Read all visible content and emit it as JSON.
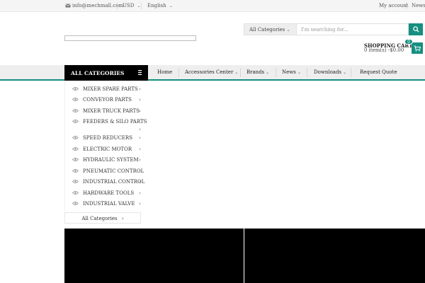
{
  "topbar": {
    "email": "info@mechmall.com",
    "currency": "USD",
    "language": "English",
    "my_account": "My account",
    "news": "News"
  },
  "search": {
    "category": "All Categories",
    "placeholder": "I'm searching for..."
  },
  "cart": {
    "title": "SHOPPING CART",
    "summary": "0 item(s) -$0.00",
    "count": "0"
  },
  "nav": {
    "all_categories": "ALL CATEGORIES",
    "items": [
      {
        "label": "Home"
      },
      {
        "label": "Accessories Center"
      },
      {
        "label": "Brands"
      },
      {
        "label": "News"
      },
      {
        "label": "Downloads"
      },
      {
        "label": "Request Quote"
      }
    ]
  },
  "categories": {
    "items": [
      {
        "label": "MIXER SPARE PARTS"
      },
      {
        "label": "CONVEYOR PARTS"
      },
      {
        "label": "MIXER TRUCK PARTS"
      },
      {
        "label": "FEEDERS & SILO PARTS"
      },
      {
        "label": "SPEED REDUCERS"
      },
      {
        "label": "ELECTRIC MOTOR"
      },
      {
        "label": "HYDRAULIC SYSTEM"
      },
      {
        "label": "PNEUMATIC CONTROL"
      },
      {
        "label": "INDUSTRIAL CONTROL"
      },
      {
        "label": "HARDWARE TOOLS"
      },
      {
        "label": "INDUSTRIAL VALVE"
      }
    ],
    "all_label": "All Categories"
  },
  "colors": {
    "accent": "#148f80",
    "menu_bg": "#000000",
    "banner_bg": "#000000"
  }
}
